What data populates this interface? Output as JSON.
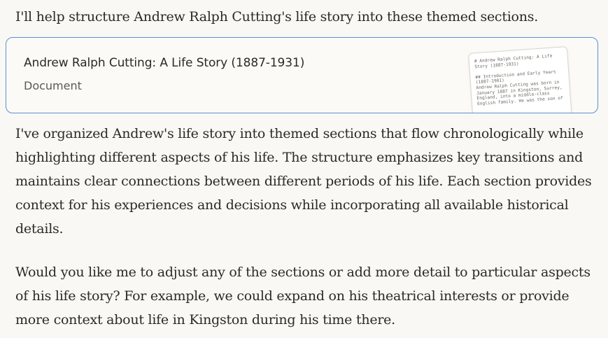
{
  "message": {
    "intro": "I'll help structure Andrew Ralph Cutting's life story into these themed sections.",
    "summary": "I've organized Andrew's life story into themed sections that flow chronologically while highlighting different aspects of his life. The structure emphasizes key transitions and maintains clear connections between different periods of his life. Each section provides context for his experiences and decisions while incorporating all available historical details.",
    "followup": "Would you like me to adjust any of the sections or add more detail to particular aspects of his life story? For example, we could expand on his theatrical interests or provide more context about life in Kingston during his time there."
  },
  "artifact": {
    "title": "Andrew Ralph Cutting: A Life Story (1887-1931)",
    "type": "Document",
    "preview": "# Andrew Ralph Cutting: A Life Story (1887-1931)\n\n## Introduction and Early Years (1887-1901)\nAndrew Ralph Cutting was born in January 1887 in Kingston, Surrey, England, into a middle-class English family. He was the son of"
  }
}
